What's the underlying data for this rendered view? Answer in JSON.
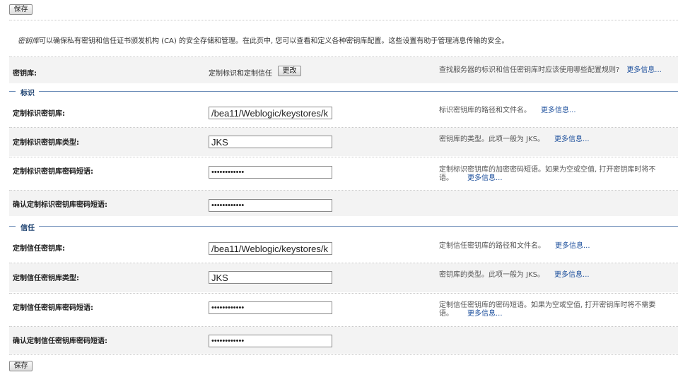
{
  "toolbar": {
    "save_label": "保存"
  },
  "intro": {
    "keyword": "密钥库",
    "text": "可以确保私有密钥和信任证书颁发机构 (CA) 的安全存储和管理。在此页中, 您可以查看和定义各种密钥库配置。这些设置有助于管理消息传输的安全。"
  },
  "keystore": {
    "label": "密钥库:",
    "value": "定制标识和定制信任",
    "change_label": "更改",
    "help": "查找服务器的标识和信任密钥库时应该使用哪些配置规则?",
    "more": "更多信息..."
  },
  "identity": {
    "title": "标识",
    "rows": [
      {
        "label": "定制标识密钥库:",
        "value": "/bea11/Weblogic/keystores/k",
        "desc1": "标识密钥库的路径和文件名。",
        "desc2": "",
        "more": "更多信息..."
      },
      {
        "label": "定制标识密钥库类型:",
        "value": "JKS",
        "desc1": "密钥库的类型。此项一般为 JKS。",
        "desc2": "",
        "more": "更多信息..."
      },
      {
        "label": "定制标识密钥库密码短语:",
        "value": "••••••••••••",
        "desc1": "定制标识密钥库的加密密码短语。如果为空或空值, 打开密钥库时将不",
        "desc2": "语。",
        "more": "更多信息..."
      },
      {
        "label": "确认定制标识密钥库密码短语:",
        "value": "••••••••••••"
      }
    ]
  },
  "trust": {
    "title": "信任",
    "rows": [
      {
        "label": "定制信任密钥库:",
        "value": "/bea11/Weblogic/keystores/k",
        "desc1": "定制信任密钥库的路径和文件名。",
        "desc2": "",
        "more": "更多信息..."
      },
      {
        "label": "定制信任密钥库类型:",
        "value": "JKS",
        "desc1": "密钥库的类型。此项一般为 JKS。",
        "desc2": "",
        "more": "更多信息..."
      },
      {
        "label": "定制信任密钥库密码短语:",
        "value": "••••••••••••",
        "desc1": "定制信任密钥库的密码短语。如果为空或空值, 打开密钥库时将不需要",
        "desc2": "语。",
        "more": "更多信息..."
      },
      {
        "label": "确认定制信任密钥库密码短语:",
        "value": "••••••••••••"
      }
    ]
  }
}
